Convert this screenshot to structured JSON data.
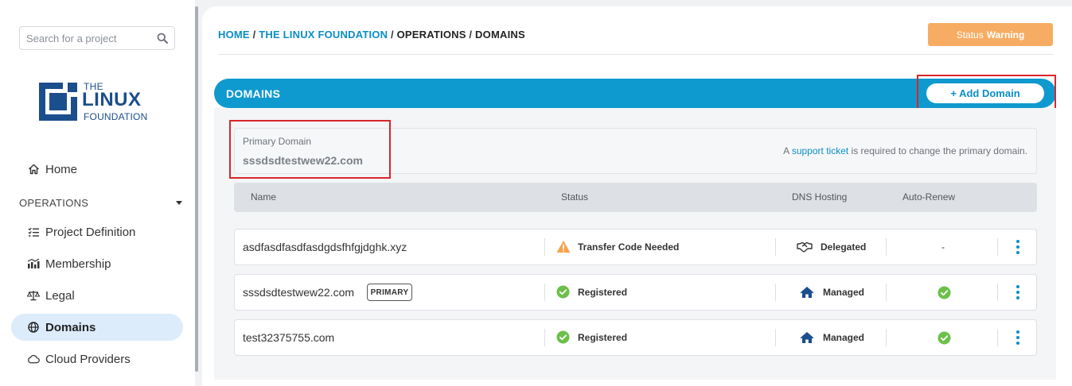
{
  "sidebar": {
    "search_placeholder": "Search for a project",
    "logo": {
      "line1": "THE",
      "line2": "LINUX",
      "line3": "FOUNDATION"
    },
    "home_label": "Home",
    "section_label": "OPERATIONS",
    "items": [
      {
        "label": "Project Definition",
        "icon": "list-check-icon"
      },
      {
        "label": "Membership",
        "icon": "chart-icon"
      },
      {
        "label": "Legal",
        "icon": "scale-icon"
      },
      {
        "label": "Domains",
        "icon": "globe-icon",
        "active": true
      },
      {
        "label": "Cloud Providers",
        "icon": "cloud-icon"
      }
    ]
  },
  "header": {
    "breadcrumb": {
      "home": "HOME",
      "sep": "/",
      "org": "THE LINUX FOUNDATION",
      "section": "OPERATIONS",
      "page": "DOMAINS"
    },
    "status_label": "Status",
    "status_value": "Warning"
  },
  "domains": {
    "title": "DOMAINS",
    "add_button": "+ Add Domain",
    "primary_label": "Primary Domain",
    "primary_value": "sssdsdtestwew22.com",
    "note_pre": "A ",
    "note_link": "support ticket",
    "note_post": " is required to change the primary domain.",
    "columns": [
      "Name",
      "Status",
      "DNS Hosting",
      "Auto-Renew"
    ],
    "rows": [
      {
        "name": "asdfasdfasdfasdgdsfhfgjdghk.xyz",
        "status": "Transfer Code Needed",
        "dns": "Delegated",
        "auto_renew": "-"
      },
      {
        "name": "sssdsdtestwew22.com",
        "badge": "PRIMARY",
        "status": "Registered",
        "dns": "Managed",
        "auto_renew": "check"
      },
      {
        "name": "test32375755.com",
        "status": "Registered",
        "dns": "Managed",
        "auto_renew": "check"
      }
    ]
  },
  "colors": {
    "accent": "#0f9acf",
    "warning": "#f7ac63",
    "success": "#6cc04a",
    "highlight": "#d9262b"
  }
}
